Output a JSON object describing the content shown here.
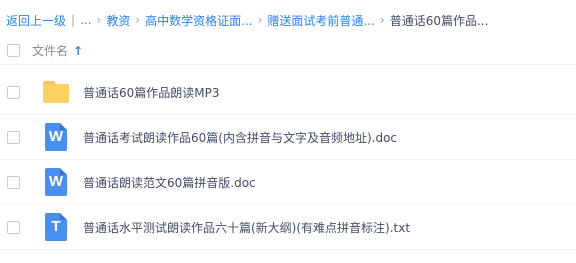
{
  "breadcrumb": {
    "back": "返回上一级",
    "ellipsis": "...",
    "items": [
      "教资",
      "高中数学资格证面...",
      "赠送面试考前普通..."
    ],
    "current": "普通话60篇作品..."
  },
  "header": {
    "checkbox_checked": false,
    "label": "文件名",
    "sort": "↑"
  },
  "files": [
    {
      "name": "普通话60篇作品朗读MP3",
      "icon": "folder-icon",
      "color": "#fcd164"
    },
    {
      "name": "普通话考试朗读作品60篇(内含拼音与文字及音频地址).doc",
      "icon": "word-doc-icon",
      "color": "#4a8ef2",
      "letter": "W"
    },
    {
      "name": "普通话朗读范文60篇拼音版.doc",
      "icon": "word-doc-icon",
      "color": "#4a8ef2",
      "letter": "W"
    },
    {
      "name": "普通话水平测试朗读作品六十篇(新大纲)(有难点拼音标注).txt",
      "icon": "text-file-icon",
      "color": "#4a8ef2",
      "letter": "T"
    }
  ]
}
